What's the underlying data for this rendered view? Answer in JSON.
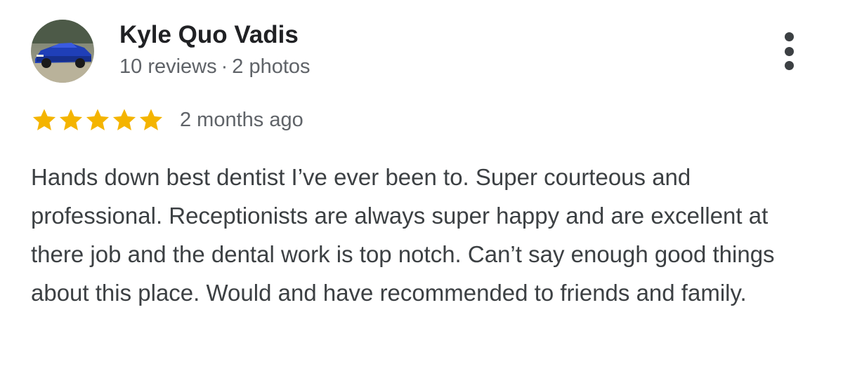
{
  "review": {
    "author": {
      "name": "Kyle Quo Vadis",
      "reviews_count": "10 reviews",
      "separator": "·",
      "photos_count": "2 photos",
      "avatar_icon": "car-avatar"
    },
    "rating": {
      "stars": 5,
      "max_stars": 5,
      "star_color": "#f4b400",
      "time_ago": "2 months ago"
    },
    "text": "Hands down best dentist I’ve ever been to. Super courteous and professional. Receptionists are always super happy and are excellent at there job and the dental work is top notch. Can’t say enough good things about this place. Would and have recommended to friends and family.",
    "menu_icon": "more-vertical-icon"
  }
}
